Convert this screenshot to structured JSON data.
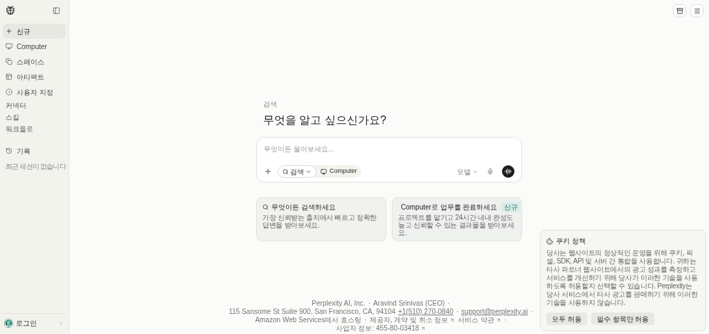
{
  "sidebar": {
    "items": [
      {
        "label": "신규",
        "kind": "nav",
        "selected": true
      },
      {
        "label": "Computer",
        "kind": "nav",
        "selected": false
      },
      {
        "label": "스페이스",
        "kind": "nav",
        "selected": false
      },
      {
        "label": "아티팩트",
        "kind": "nav",
        "selected": false
      },
      {
        "label": "사용자 지정",
        "kind": "nav",
        "selected": false
      },
      {
        "label": "커넥터",
        "kind": "sub",
        "selected": false
      },
      {
        "label": "스킬",
        "kind": "sub",
        "selected": false
      },
      {
        "label": "워크플로",
        "kind": "sub",
        "selected": false
      },
      {
        "label": "기록",
        "kind": "nav",
        "selected": false
      }
    ],
    "empty_note": "최근 세션이 없습니다",
    "login": "로그인"
  },
  "main": {
    "eyebrow": "검색",
    "heading": "무엇을 알고 싶으신가요?",
    "composer": {
      "placeholder": "무엇이든 물어보세요...",
      "mode": "검색",
      "computer": "Computer",
      "model": "모델"
    },
    "cards": [
      {
        "title": "무엇이든 검색하세요",
        "description": "가장 신뢰받는 출처에서 빠르고 정확한 답변을 받아보세요."
      },
      {
        "title": "Computer로 업무를 완료하세요",
        "badge": "신규",
        "description": "프로젝트를 맡기고 24시간 내내 완성도 높고 신뢰할 수 있는 결과물을 받아보세요."
      }
    ]
  },
  "cookie": {
    "title": "쿠키 정책",
    "body": "당사는 웹사이트의 정상적인 운영을 위해 쿠키, 픽셀, SDK, API 및 서버 간 통합을 사용합니다. 귀하는 타사 파트너 웹사이트에서의 광고 성과를 측정하고 서비스를 개선하기 위해 당사가 이러한 기술을 사용하도록 허용할지 선택할 수 있습니다. Perplexity는 당사 서비스에서 타사 광고를 판매하기 위해 이러한 기술을 사용하지 않습니다.",
    "buttons": [
      "모두 허용",
      "필수 항목만 허용"
    ]
  },
  "footer": {
    "items": [
      {
        "text": "Perplexity AI, Inc.",
        "kind": "text"
      },
      {
        "text": "·",
        "kind": "sep"
      },
      {
        "text": "Aravind Srinivas (CEO)",
        "kind": "text"
      },
      {
        "text": "·",
        "kind": "sep"
      },
      {
        "text": "115 Sansome St Suite 900, San Francisco, CA, 94104",
        "kind": "text"
      },
      {
        "text": "+1(510) 270-0840",
        "kind": "link"
      },
      {
        "text": "·",
        "kind": "sep"
      },
      {
        "text": "support@perplexity.ai",
        "kind": "link"
      },
      {
        "text": "·",
        "kind": "sep"
      },
      {
        "text": "Amazon Web Services에서 호스팅",
        "kind": "text"
      },
      {
        "text": "·",
        "kind": "sep"
      },
      {
        "text": "제공자, 계약 및 취소 정보",
        "kind": "external"
      },
      {
        "text": "서비스 약관",
        "kind": "external"
      },
      {
        "text": "·",
        "kind": "sep"
      },
      {
        "text": "사업자 정보: 455-80-03418",
        "kind": "external"
      }
    ]
  }
}
